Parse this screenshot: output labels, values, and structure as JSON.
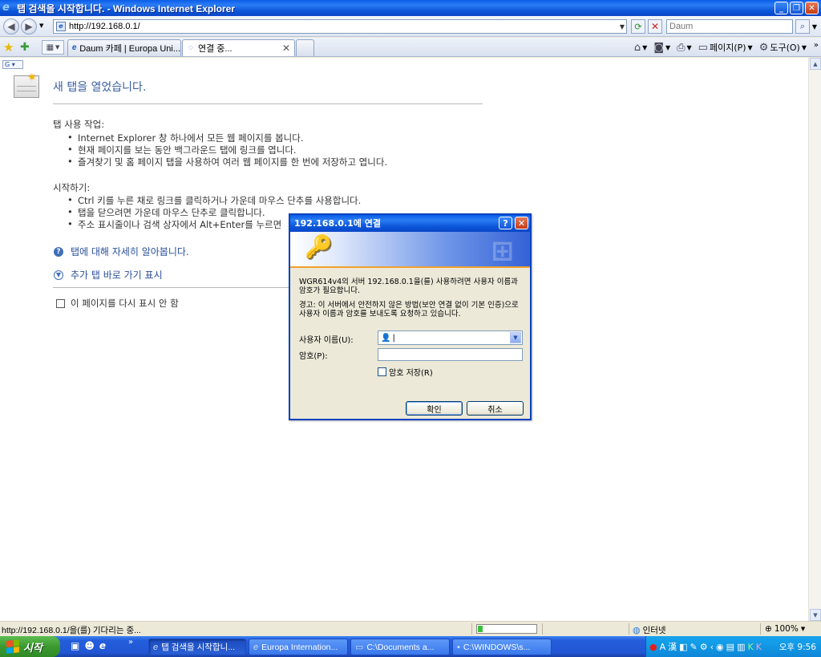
{
  "window": {
    "title": "탭 검색을 시작합니다. - Windows Internet Explorer"
  },
  "addressbar": {
    "url": "http://192.168.0.1/",
    "search_placeholder": "Daum"
  },
  "tabs": [
    {
      "label": "Daum 카페 | Europa Uni...",
      "active": false
    },
    {
      "label": "연결 중...",
      "active": true
    }
  ],
  "commandbar": {
    "page_label": "페이지(P)",
    "tools_label": "도구(O)"
  },
  "content": {
    "heading": "새 탭을 열었습니다.",
    "section1_title": "탭 사용 작업:",
    "section1_items": [
      "Internet Explorer 창 하나에서 모든 웹 페이지를 봅니다.",
      "현재 페이지를 보는 동안 백그라운드 탭에 링크를 엽니다.",
      "즐겨찾기 및 홈 페이지 탭을 사용하여 여러 웹 페이지를 한 번에 저장하고 엽니다."
    ],
    "section2_title": "시작하기:",
    "section2_items": [
      "Ctrl 키를 누른 채로 링크를 클릭하거나 가운데 마우스 단추를 사용합니다.",
      "탭을 닫으려면 가운데 마우스 단추로 클릭합니다.",
      "주소 표시줄이나 검색 상자에서 Alt+Enter를 누르면"
    ],
    "learn_more_link": "탭에 대해 자세히 알아봅니다.",
    "shortcuts_link": "추가 탭 바로 가기 표시",
    "dont_show_label": "이 페이지를 다시 표시 안 함"
  },
  "dialog": {
    "title": "192.168.0.1에 연결",
    "message": "WGR614v4의 서버 192.168.0.1을(를) 사용하려면 사용자 이름과 암호가 필요합니다.",
    "warning": "경고: 이 서버에서 안전하지 않은 방법(보안 연결 없이 기본 인증)으로 사용자 이름과 암호를 보내도록 요청하고 있습니다.",
    "username_label": "사용자 이름(U):",
    "username_value": "|",
    "password_label": "암호(P):",
    "password_value": "",
    "remember_label": "암호 저장(R)",
    "ok_label": "확인",
    "cancel_label": "취소"
  },
  "statusbar": {
    "text": "http://192.168.0.1/을(를) 기다리는 중...",
    "progress": 0.08,
    "zone": "인터넷",
    "zoom": "100%"
  },
  "taskbar": {
    "start_label": "시작",
    "tasks": [
      "탭 검색을 시작합니...",
      "Europa Internation...",
      "C:\\Documents a...",
      "C:\\WINDOWS\\s..."
    ],
    "clock": "오후 9:56"
  }
}
